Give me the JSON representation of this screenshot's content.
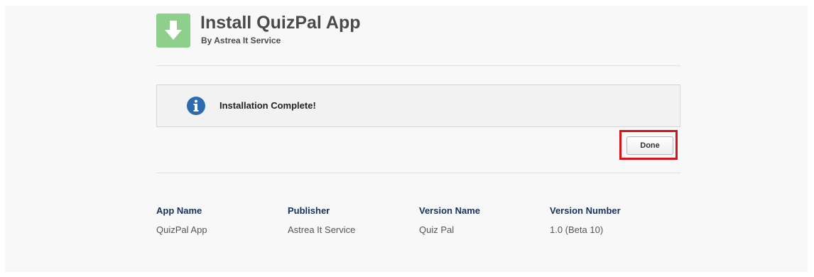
{
  "header": {
    "title": "Install QuizPal App",
    "subtitle": "By Astrea It Service",
    "icon": "download-arrow-icon"
  },
  "notice": {
    "icon": "info-icon",
    "message": "Installation Complete!"
  },
  "actions": {
    "done_label": "Done"
  },
  "details": {
    "columns": [
      {
        "header": "App Name",
        "value": "QuizPal App"
      },
      {
        "header": "Publisher",
        "value": "Astrea It Service"
      },
      {
        "header": "Version Name",
        "value": "Quiz Pal"
      },
      {
        "header": "Version Number",
        "value": "1.0 (Beta 10)"
      }
    ]
  },
  "colors": {
    "app_icon_bg": "#8fcf8c",
    "info_icon": "#2b6cb0",
    "highlight": "#d7131a",
    "header_text": "#16325c"
  }
}
